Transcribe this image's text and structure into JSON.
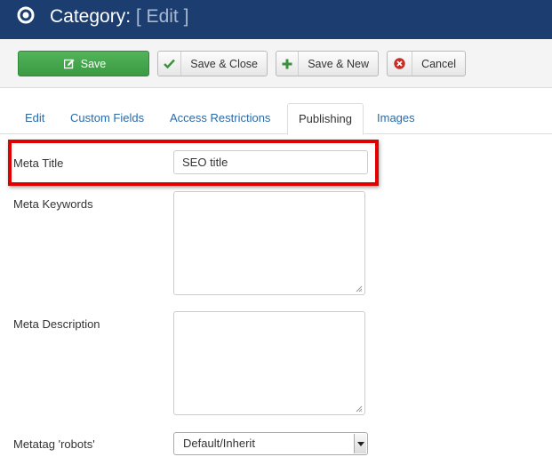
{
  "header": {
    "title": "Category:",
    "subtitle": "[ Edit ]"
  },
  "toolbar": {
    "save_label": "Save",
    "save_close_label": "Save & Close",
    "save_new_label": "Save & New",
    "cancel_label": "Cancel"
  },
  "tabs": [
    {
      "label": "Edit",
      "active": false
    },
    {
      "label": "Custom Fields",
      "active": false
    },
    {
      "label": "Access Restrictions",
      "active": false
    },
    {
      "label": "Publishing",
      "active": true
    },
    {
      "label": "Images",
      "active": false
    }
  ],
  "form": {
    "meta_title": {
      "label": "Meta Title",
      "value": "SEO title"
    },
    "meta_keywords": {
      "label": "Meta Keywords",
      "value": ""
    },
    "meta_description": {
      "label": "Meta Description",
      "value": ""
    },
    "robots": {
      "label": "Metatag 'robots'",
      "selected": "Default/Inherit"
    }
  },
  "colors": {
    "header_bg": "#1b3d70",
    "save_green": "#46a546",
    "highlight_red": "#e00000",
    "link_blue": "#2a6aa8"
  },
  "icons": {
    "header": "target-icon",
    "save": "edit-icon",
    "save_close": "check-icon",
    "save_new": "plus-icon",
    "cancel": "cancel-circle-icon"
  }
}
